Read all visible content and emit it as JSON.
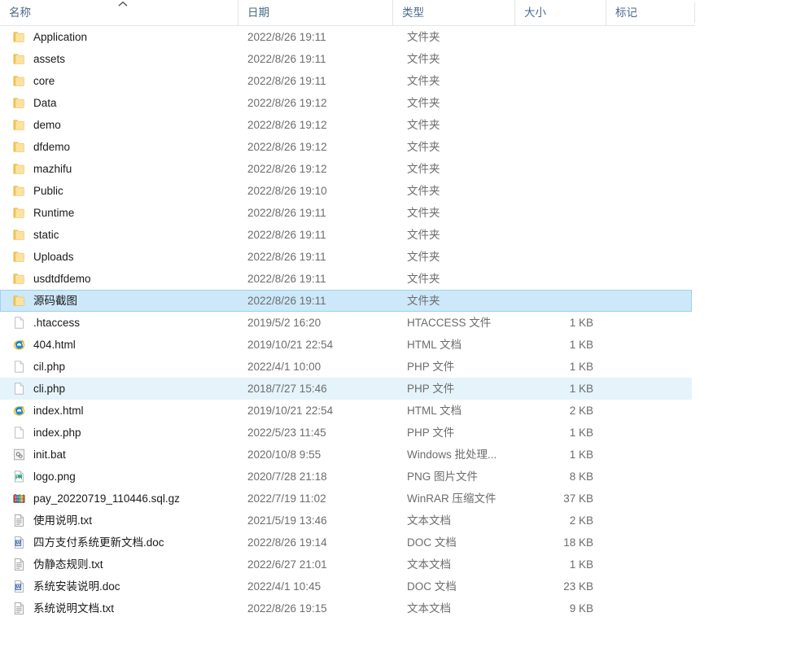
{
  "columns": {
    "name": "名称",
    "date": "日期",
    "type": "类型",
    "size": "大小",
    "tags": "标记"
  },
  "sort": {
    "column": "名称",
    "direction": "ascending",
    "icon": "chevron-up-icon"
  },
  "colors": {
    "selected_fill": "#cce8f9",
    "selected_border": "#9cd2f0",
    "hover_fill": "#e5f3fb",
    "header_text": "#4a6a8a",
    "secondary_text": "#6d6d6d",
    "folder_yellow": "#f6d68a"
  },
  "rows": [
    {
      "name": "Application",
      "date": "2022/8/26 19:11",
      "type": "文件夹",
      "size": "",
      "tags": "",
      "icon": "folder-icon",
      "state": "normal"
    },
    {
      "name": "assets",
      "date": "2022/8/26 19:11",
      "type": "文件夹",
      "size": "",
      "tags": "",
      "icon": "folder-icon",
      "state": "normal"
    },
    {
      "name": "core",
      "date": "2022/8/26 19:11",
      "type": "文件夹",
      "size": "",
      "tags": "",
      "icon": "folder-icon",
      "state": "normal"
    },
    {
      "name": "Data",
      "date": "2022/8/26 19:12",
      "type": "文件夹",
      "size": "",
      "tags": "",
      "icon": "folder-icon",
      "state": "normal"
    },
    {
      "name": "demo",
      "date": "2022/8/26 19:12",
      "type": "文件夹",
      "size": "",
      "tags": "",
      "icon": "folder-icon",
      "state": "normal"
    },
    {
      "name": "dfdemo",
      "date": "2022/8/26 19:12",
      "type": "文件夹",
      "size": "",
      "tags": "",
      "icon": "folder-icon",
      "state": "normal"
    },
    {
      "name": "mazhifu",
      "date": "2022/8/26 19:12",
      "type": "文件夹",
      "size": "",
      "tags": "",
      "icon": "folder-icon",
      "state": "normal"
    },
    {
      "name": "Public",
      "date": "2022/8/26 19:10",
      "type": "文件夹",
      "size": "",
      "tags": "",
      "icon": "folder-icon",
      "state": "normal"
    },
    {
      "name": "Runtime",
      "date": "2022/8/26 19:11",
      "type": "文件夹",
      "size": "",
      "tags": "",
      "icon": "folder-icon",
      "state": "normal"
    },
    {
      "name": "static",
      "date": "2022/8/26 19:11",
      "type": "文件夹",
      "size": "",
      "tags": "",
      "icon": "folder-icon",
      "state": "normal"
    },
    {
      "name": "Uploads",
      "date": "2022/8/26 19:11",
      "type": "文件夹",
      "size": "",
      "tags": "",
      "icon": "folder-icon",
      "state": "normal"
    },
    {
      "name": "usdtdfdemo",
      "date": "2022/8/26 19:11",
      "type": "文件夹",
      "size": "",
      "tags": "",
      "icon": "folder-icon",
      "state": "normal"
    },
    {
      "name": "源码截图",
      "date": "2022/8/26 19:11",
      "type": "文件夹",
      "size": "",
      "tags": "",
      "icon": "folder-icon",
      "state": "selected"
    },
    {
      "name": ".htaccess",
      "date": "2019/5/2 16:20",
      "type": "HTACCESS 文件",
      "size": "1 KB",
      "tags": "",
      "icon": "blank-file-icon",
      "state": "normal"
    },
    {
      "name": "404.html",
      "date": "2019/10/21 22:54",
      "type": "HTML 文档",
      "size": "1 KB",
      "tags": "",
      "icon": "internet-explorer-icon",
      "state": "normal"
    },
    {
      "name": "cil.php",
      "date": "2022/4/1 10:00",
      "type": "PHP 文件",
      "size": "1 KB",
      "tags": "",
      "icon": "blank-file-icon",
      "state": "normal"
    },
    {
      "name": "cli.php",
      "date": "2018/7/27 15:46",
      "type": "PHP 文件",
      "size": "1 KB",
      "tags": "",
      "icon": "blank-file-icon",
      "state": "hovered"
    },
    {
      "name": "index.html",
      "date": "2019/10/21 22:54",
      "type": "HTML 文档",
      "size": "2 KB",
      "tags": "",
      "icon": "internet-explorer-icon",
      "state": "normal"
    },
    {
      "name": "index.php",
      "date": "2022/5/23 11:45",
      "type": "PHP 文件",
      "size": "1 KB",
      "tags": "",
      "icon": "blank-file-icon",
      "state": "normal"
    },
    {
      "name": "init.bat",
      "date": "2020/10/8 9:55",
      "type": "Windows 批处理...",
      "size": "1 KB",
      "tags": "",
      "icon": "batch-file-icon",
      "state": "normal"
    },
    {
      "name": "logo.png",
      "date": "2020/7/28 21:18",
      "type": "PNG 图片文件",
      "size": "8 KB",
      "tags": "",
      "icon": "png-image-icon",
      "state": "normal"
    },
    {
      "name": "pay_20220719_110446.sql.gz",
      "date": "2022/7/19 11:02",
      "type": "WinRAR 压缩文件",
      "size": "37 KB",
      "tags": "",
      "icon": "winrar-archive-icon",
      "state": "normal"
    },
    {
      "name": "使用说明.txt",
      "date": "2021/5/19 13:46",
      "type": "文本文档",
      "size": "2 KB",
      "tags": "",
      "icon": "text-file-icon",
      "state": "normal"
    },
    {
      "name": "四方支付系统更新文档.doc",
      "date": "2022/8/26 19:14",
      "type": "DOC 文档",
      "size": "18 KB",
      "tags": "",
      "icon": "word-doc-icon",
      "state": "normal"
    },
    {
      "name": "伪静态规则.txt",
      "date": "2022/6/27 21:01",
      "type": "文本文档",
      "size": "1 KB",
      "tags": "",
      "icon": "text-file-icon",
      "state": "normal"
    },
    {
      "name": "系统安装说明.doc",
      "date": "2022/4/1 10:45",
      "type": "DOC 文档",
      "size": "23 KB",
      "tags": "",
      "icon": "word-doc-icon",
      "state": "normal"
    },
    {
      "name": "系统说明文档.txt",
      "date": "2022/8/26 19:15",
      "type": "文本文档",
      "size": "9 KB",
      "tags": "",
      "icon": "text-file-icon",
      "state": "normal"
    }
  ]
}
